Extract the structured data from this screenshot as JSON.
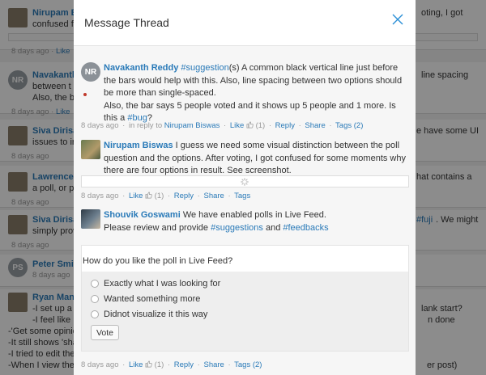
{
  "background": {
    "posts": [
      {
        "name": "Nirupam B",
        "right1": "oting, I got",
        "line1": "confused fo",
        "meta_age": "8 days ago",
        "meta_like": "Like"
      },
      {
        "initials": "NR",
        "name": "Navakanth",
        "line1": "between t",
        "right1": "line spacing",
        "line2": "Also, the ba",
        "meta_age": "8 days ago",
        "meta_like": "Like"
      },
      {
        "name": "Siva Dirisa",
        "right1": "e have some UI",
        "line1": "issues to ir",
        "meta_age": "8 days ago"
      },
      {
        "name": "Lawrence",
        "right1": "hat contains a",
        "line1": "a poll, or pert",
        "meta_age": "8 days ago"
      },
      {
        "name": "Siva Dirisa",
        "right1": "#fuji",
        "right2": ". We might",
        "line1": "simply prov",
        "meta_age": "8 days ago"
      },
      {
        "initials": "PS",
        "name": "Peter Smit",
        "meta_age": "8 days ago"
      },
      {
        "name": "Ryan Manr",
        "right1": "lank start?",
        "line1": "-I set up a",
        "line2": "-I feel like I",
        "right2": "n done",
        "line3": "-'Get some opinio",
        "line4": "-It still shows 'sha",
        "line5": "-I tried to edit the",
        "line6": "-When I view the s",
        "right3": "er post)"
      }
    ]
  },
  "modal": {
    "title": "Message Thread",
    "close_label": "×",
    "messages": [
      {
        "initials": "NR",
        "author": "Navakanth Reddy",
        "hashtag1": "#suggestion",
        "text1": "(s) A common black vertical line just before the bars would help with this. Also, line spacing between two options should be more than single-spaced.",
        "text2": "Also, the bar says 5 people voted and it shows up 5 people and 1 more. Is this a ",
        "hashtag2": "#bug",
        "text3": "?",
        "age": "8 days ago",
        "reply_prefix": "in reply to",
        "reply_to": "Nirupam Biswas",
        "like": "Like",
        "like_count": "(1)",
        "reply": "Reply",
        "share": "Share",
        "tags": "Tags (2)"
      },
      {
        "author": "Nirupam Biswas",
        "text1": "I guess we need some visual distinction between the poll question and the options. After voting, I got confused for some moments why there are four options in result. See screenshot.",
        "age": "8 days ago",
        "like": "Like",
        "like_count": "(1)",
        "reply": "Reply",
        "share": "Share",
        "tags": "Tags"
      },
      {
        "author": "Shouvik Goswami",
        "text1": "We have enabled polls in Live Feed.",
        "text2": "Please review and provide ",
        "hashtag1": "#suggestions",
        "and": " and ",
        "hashtag2": "#feedbacks",
        "age": "8 days ago",
        "like": "Like",
        "like_count": "(1)",
        "reply": "Reply",
        "share": "Share",
        "tags": "Tags (2)"
      }
    ],
    "poll": {
      "question": "How do you like the poll in Live Feed?",
      "options": [
        "Exactly what I was looking for",
        "Wanted something more",
        "Didnot visualize it this way"
      ],
      "vote_label": "Vote"
    }
  },
  "colors": {
    "link": "#2a7ab8",
    "close": "#2a8fd6"
  }
}
